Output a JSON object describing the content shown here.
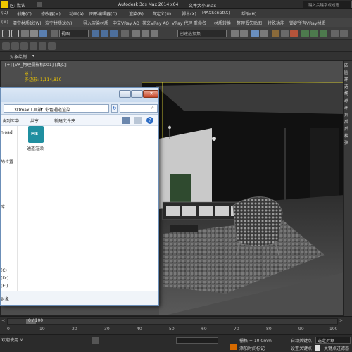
{
  "titlebar": {
    "workspace": "区: 默认",
    "app_title": "Autodesk 3ds Max  2014 x64",
    "file_name": "文件大小.max",
    "search_placeholder": "键入关键字或短语"
  },
  "menubar": {
    "items": [
      "(D)",
      "创建(C)",
      "修改器(M)",
      "动画(A)",
      "图形编辑器(D)",
      "渲染(R)",
      "自定义(U)",
      "脚本(X)",
      "MAXScript(X)",
      "帮助(H)"
    ]
  },
  "toolbar1": {
    "items": [
      "(M)",
      "清空材质球(W)",
      "渲空材质球(Y)",
      "导入渲染材质",
      "中文VRay AO",
      "英文VRay AO",
      "VRay 代理",
      "重命名",
      "材质转换",
      "整理丢失贴图",
      "特殊功能",
      "锁定所有VRay材质"
    ]
  },
  "toolbar2": {
    "view_dropdown": "视图",
    "selection_set_placeholder": "创建选择集"
  },
  "toolbar3": {
    "label": "对象绘制"
  },
  "viewport": {
    "label": "[+] [VR_物理摄影机001] [真实]",
    "stats_label": "总计",
    "stats_value": "多边形: 1,114,810"
  },
  "right_panel": {
    "labels": [
      "四",
      "圆",
      "环",
      "选择",
      "切",
      "球",
      "环",
      "异",
      "后",
      "后",
      "棱",
      "弦"
    ]
  },
  "explorer": {
    "breadcrumb_1": "3Dmax工具箱",
    "breadcrumb_2": "彩色通道渲染",
    "cmd_include": "含到库中",
    "cmd_share": "共享",
    "cmd_new_folder": "新建文件夹",
    "nav_items": [
      "nload",
      "的位置",
      "库",
      "(C)",
      "(D:)",
      "(E:)"
    ],
    "file_name": "通道渲染",
    "file_badge": "MS",
    "status_text": "对象"
  },
  "timeline": {
    "frame_counter": "0 / 100",
    "ticks": [
      "0",
      "10",
      "20",
      "30",
      "40",
      "50",
      "60",
      "70",
      "80",
      "90",
      "100"
    ]
  },
  "statusbar": {
    "welcome": "欢迎使用 M",
    "grid": "栅格 = 10.0mm",
    "add_time_tag": "添加时间标记",
    "auto_key": "自动关键点",
    "set_key": "设置关键点",
    "selected": "选定对象",
    "key_filter": "关键点过滤器"
  },
  "colors": {
    "accent_yellow": "#f0c800",
    "viewport_border": "#d8cf3a",
    "explorer_border": "#6c8fb8"
  }
}
